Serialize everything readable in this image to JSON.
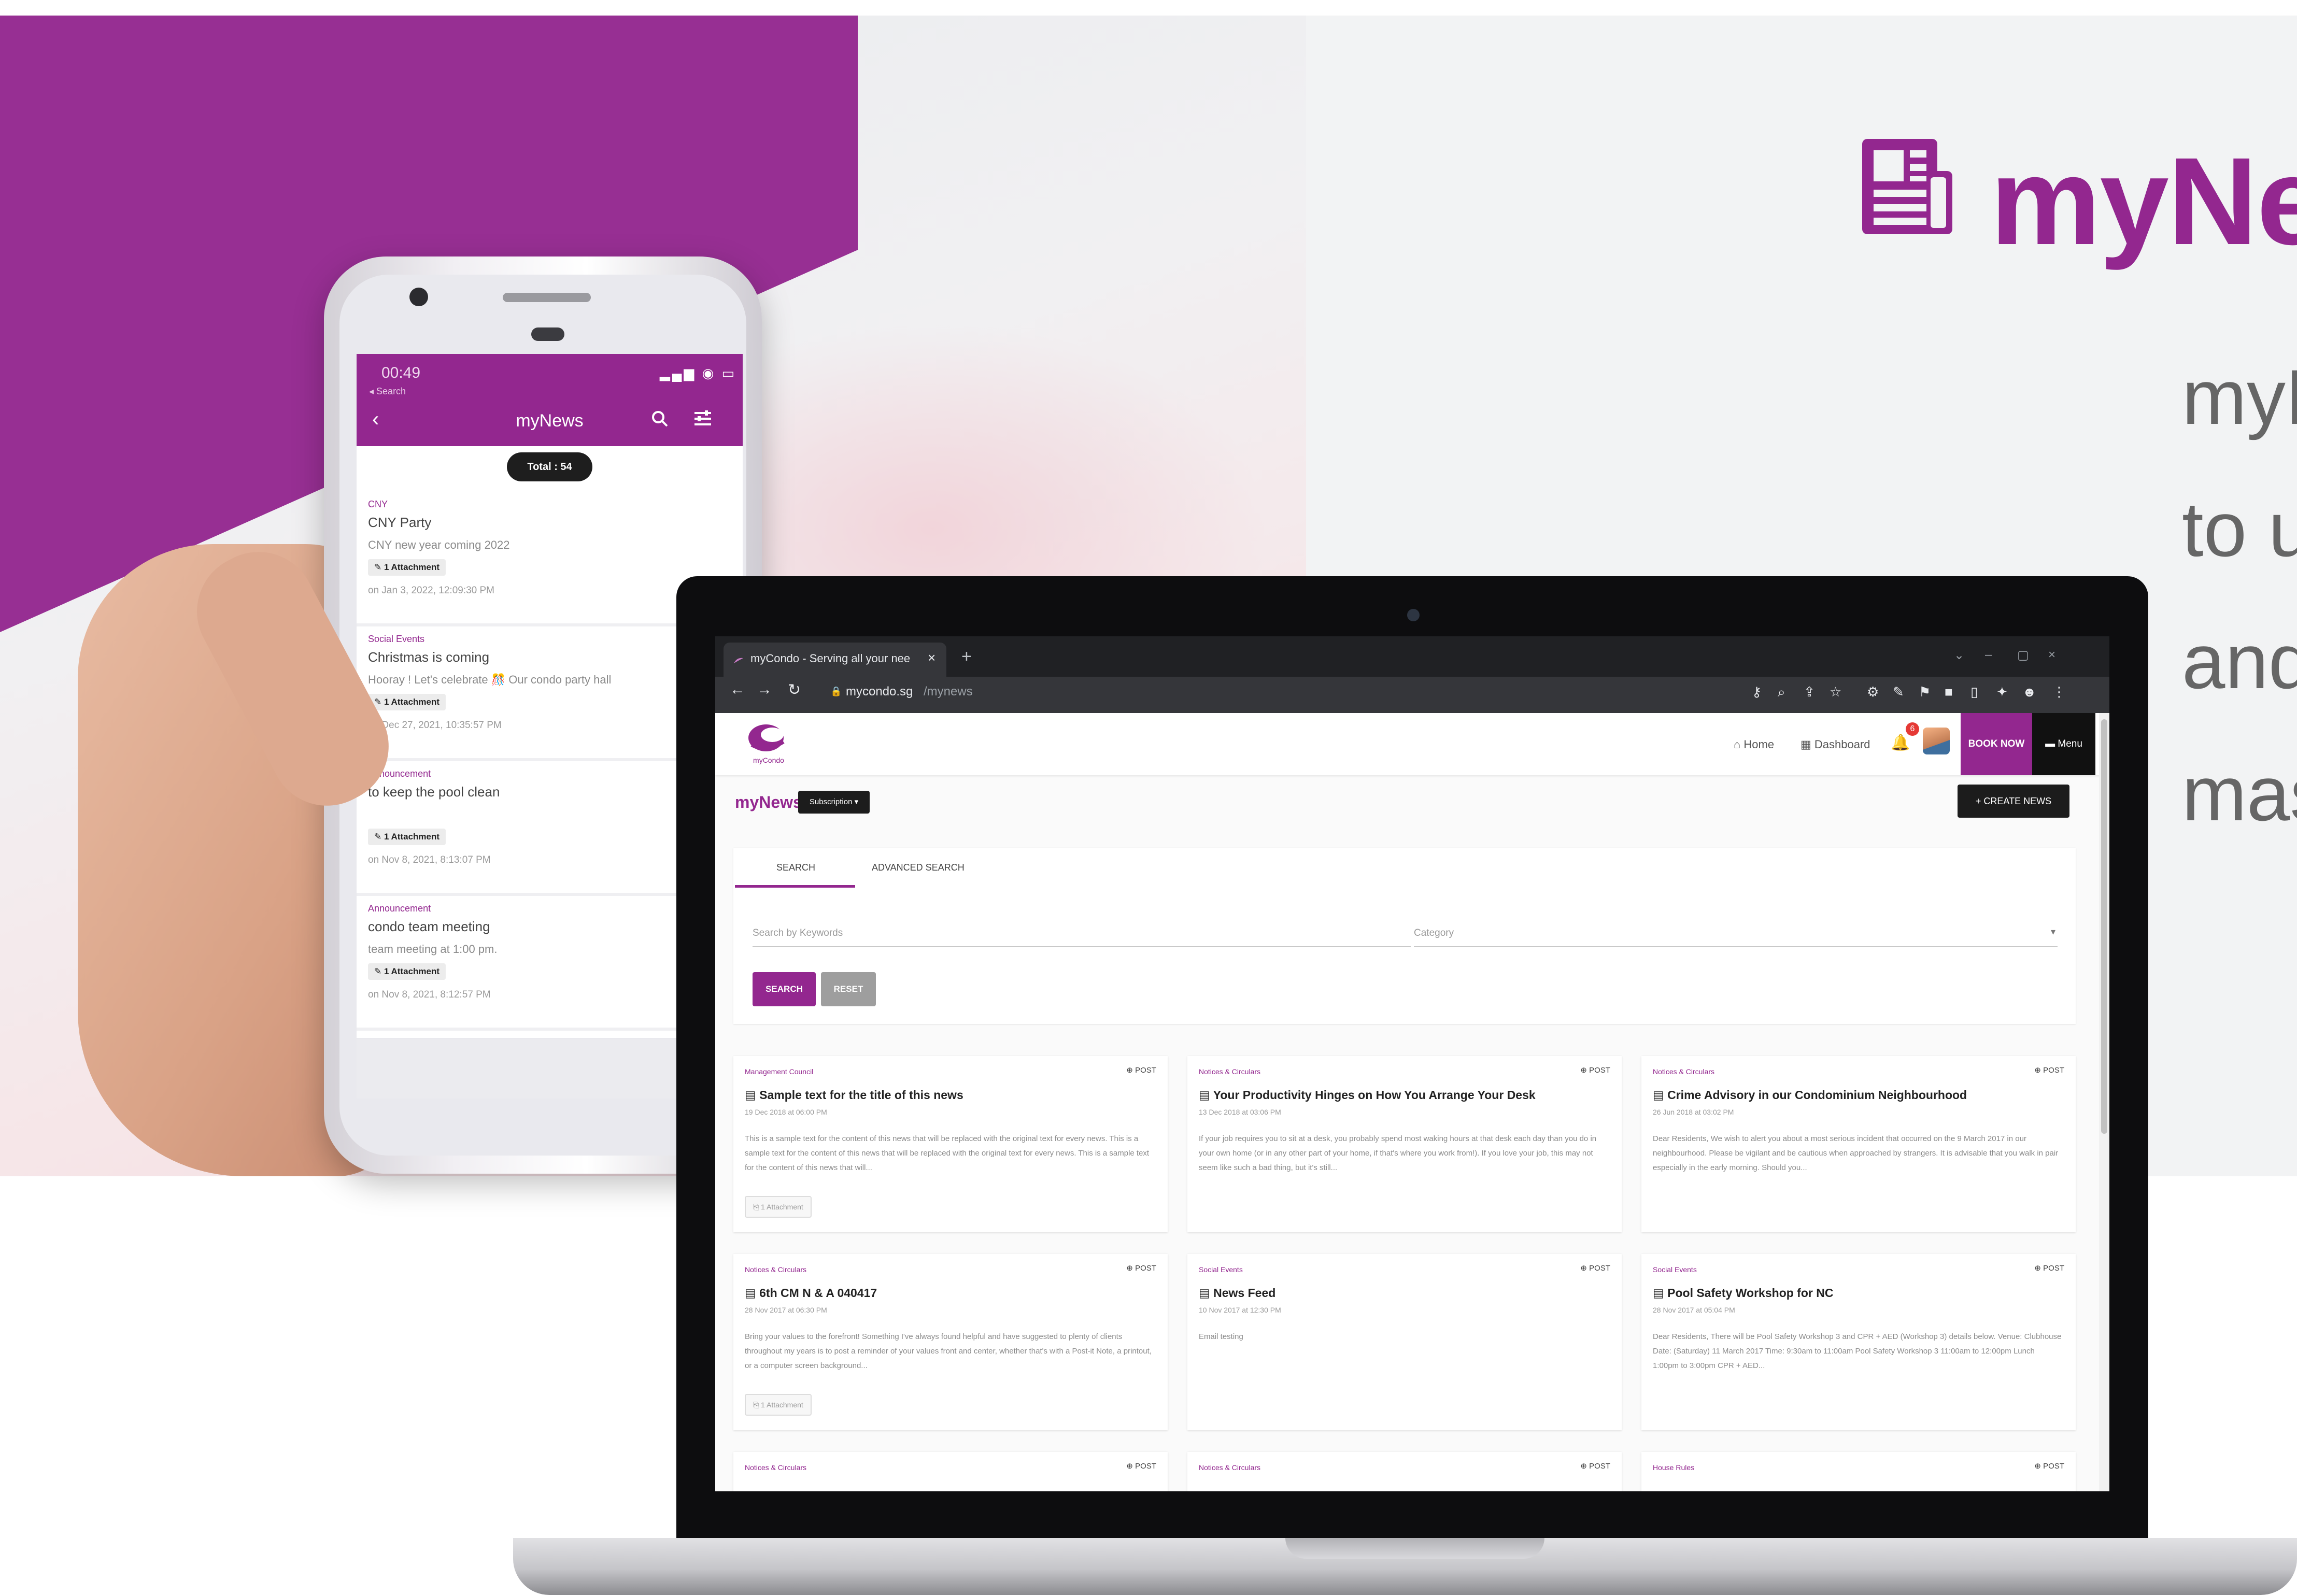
{
  "brand": {
    "title": "myNews",
    "description_lines": [
      "myN",
      "to u",
      "and",
      "mas"
    ],
    "accent_color": "#93278f"
  },
  "phone": {
    "time": "00:49",
    "back_label": "◂ Search",
    "app_title": "myNews",
    "total_label": "Total : 54",
    "items": [
      {
        "category": "CNY",
        "title": "CNY Party",
        "subtitle": "CNY new year coming 2022",
        "attachment": "✎ 1 Attachment",
        "date": "on Jan 3, 2022, 12:09:30 PM"
      },
      {
        "category": "Social Events",
        "title": "Christmas is coming",
        "subtitle": "Hooray ! Let's celebrate 🎊 Our condo party hall",
        "attachment": "✎ 1 Attachment",
        "date": "on Dec 27, 2021, 10:35:57 PM"
      },
      {
        "category": "Announcement",
        "title": "to keep the pool clean",
        "subtitle": "",
        "attachment": "✎ 1 Attachment",
        "date": "on Nov 8, 2021, 8:13:07 PM"
      },
      {
        "category": "Announcement",
        "title": "condo team meeting",
        "subtitle": "team meeting at 1:00 pm.",
        "attachment": "✎ 1 Attachment",
        "date": "on Nov 8, 2021, 8:12:57 PM"
      }
    ]
  },
  "browser": {
    "tab_title": "myCondo - Serving all your nee",
    "url_host": "mycondo.sg",
    "url_path": "/mynews"
  },
  "app": {
    "logo_text": "myCondo",
    "nav": {
      "home": "Home",
      "dashboard": "Dashboard",
      "notification_count": "6",
      "book_now": "BOOK NOW",
      "menu": "Menu"
    },
    "page_title": "myNews",
    "subscription_label": "Subscription ▾",
    "create_label": "+  CREATE NEWS",
    "tabs": {
      "search": "SEARCH",
      "advanced": "ADVANCED SEARCH"
    },
    "keywords_placeholder": "Search by Keywords",
    "category_placeholder": "Category",
    "search_button": "SEARCH",
    "reset_button": "RESET",
    "post_label": "⊕ POST",
    "cards": [
      {
        "category": "Management Council",
        "title": "Sample text for the title of this news",
        "date": "19 Dec 2018 at 06:00 PM",
        "body": "This is a sample text for the content of this news that will be replaced with the original text for every news. This is a sample text for the content of this news that will be replaced with the original text for every news. This is a sample text for the content of this news that will...",
        "attachment": "1 Attachment"
      },
      {
        "category": "Notices & Circulars",
        "title": "Your Productivity Hinges on How You Arrange Your Desk",
        "date": "13 Dec 2018 at 03:06 PM",
        "body": "If your job requires you to sit at a desk, you probably spend most waking hours at that desk each day than you do in your own home (or in any other part of your home, if that's where you work from!). If you love your job, this may not seem like such a bad thing, but it's still...",
        "attachment": ""
      },
      {
        "category": "Notices & Circulars",
        "title": "Crime Advisory in our Condominium Neighbourhood",
        "date": "26 Jun 2018 at 03:02 PM",
        "body": "Dear Residents, We wish to alert you about a most serious incident that occurred on the 9 March 2017 in our neighbourhood. Please be vigilant and be cautious when approached by strangers. It is advisable that you walk in pair especially in the early morning. Should you...",
        "attachment": ""
      },
      {
        "category": "Notices & Circulars",
        "title": "6th CM N & A 040417",
        "date": "28 Nov 2017 at 06:30 PM",
        "body": "Bring your values to the forefront! Something I've always found helpful and have suggested to plenty of clients throughout my years is to post a reminder of your values front and center, whether that's with a Post-it Note, a printout, or a computer screen background...",
        "attachment": "1 Attachment"
      },
      {
        "category": "Social Events",
        "title": "News Feed",
        "date": "10 Nov 2017 at 12:30 PM",
        "body": "Email testing",
        "attachment": ""
      },
      {
        "category": "Social Events",
        "title": "Pool Safety Workshop for NC",
        "date": "28 Nov 2017 at 05:04 PM",
        "body": "Dear Residents, There will be Pool Safety Workshop 3 and CPR + AED (Workshop 3) details below. Venue: Clubhouse Date: (Saturday) 11 March 2017 Time: 9:30am to 11:00am Pool Safety Workshop 3 11:00am to 12:00pm Lunch 1:00pm to 3:00pm CPR + AED...",
        "attachment": ""
      },
      {
        "category": "Notices & Circulars",
        "title": "",
        "date": "",
        "body": "",
        "attachment": ""
      },
      {
        "category": "Notices & Circulars",
        "title": "",
        "date": "",
        "body": "",
        "attachment": ""
      },
      {
        "category": "House Rules",
        "title": "",
        "date": "",
        "body": "",
        "attachment": ""
      }
    ]
  }
}
